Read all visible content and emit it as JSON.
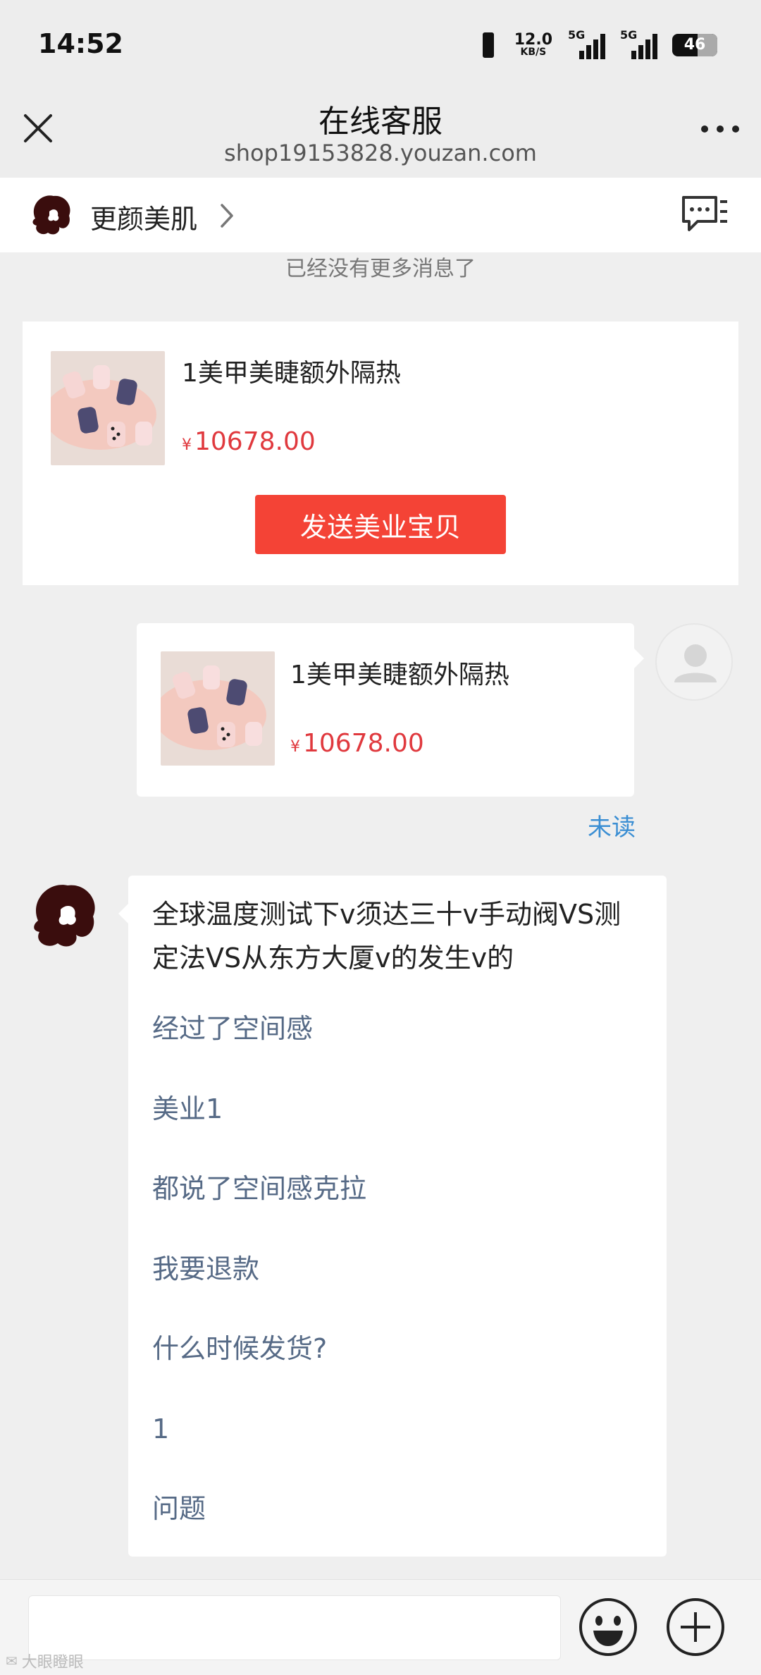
{
  "status_bar": {
    "time": "14:52",
    "net_speed": "12.0",
    "net_speed_unit": "KB/S",
    "sim1_label": "5G",
    "sim2_label": "5G",
    "battery": "46"
  },
  "nav": {
    "title": "在线客服",
    "subtitle": "shop19153828.youzan.com"
  },
  "shop": {
    "name": "更颜美肌"
  },
  "history_status": "已经没有更多消息了",
  "product_card": {
    "title": "1美甲美睫额外隔热",
    "currency": "¥",
    "price": "10678.00",
    "send_button": "发送美业宝贝"
  },
  "sent_message": {
    "title": "1美甲美睫额外隔热",
    "currency": "¥",
    "price": "10678.00",
    "read_status": "未读"
  },
  "reply": {
    "text": "全球温度测试下v须达三十v手动阀VS测定法VS从东方大厦v的发生v的",
    "faq": [
      "经过了空间感",
      "美业1",
      "都说了空间感克拉",
      "我要退款",
      "什么时候发货?",
      "1",
      "问题"
    ]
  },
  "input": {
    "placeholder": ""
  },
  "watermark": "大眼瞪眼",
  "colors": {
    "price": "#e0393e",
    "send_button": "#f44336",
    "link": "#3a8ed3",
    "faq": "#566a86"
  }
}
